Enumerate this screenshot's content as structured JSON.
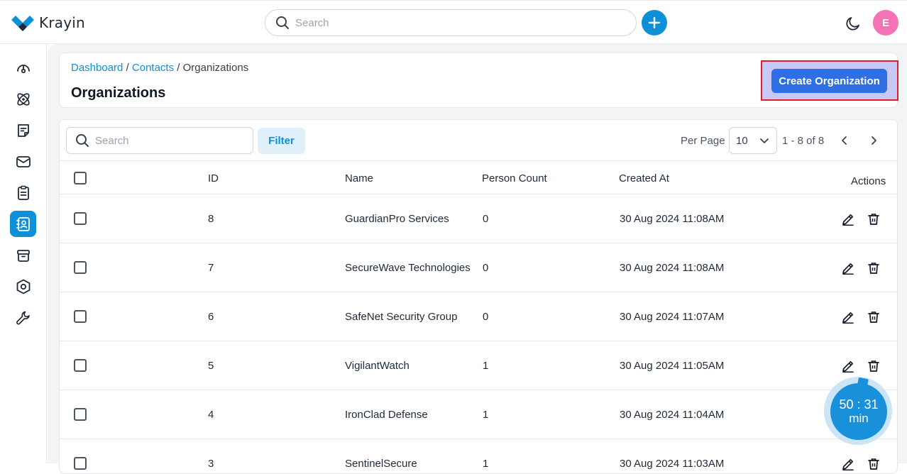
{
  "app": {
    "name": "Krayin"
  },
  "header": {
    "search_placeholder": "Search",
    "avatar_initial": "E"
  },
  "sidebar": {
    "items": [
      {
        "name": "dashboard",
        "icon": "gauge-icon",
        "active": false
      },
      {
        "name": "leads",
        "icon": "atom-icon",
        "active": false
      },
      {
        "name": "quotes",
        "icon": "note-icon",
        "active": false
      },
      {
        "name": "mail",
        "icon": "mail-icon",
        "active": false
      },
      {
        "name": "activities",
        "icon": "clipboard-icon",
        "active": false
      },
      {
        "name": "contacts",
        "icon": "contact-book-icon",
        "active": true
      },
      {
        "name": "products",
        "icon": "box-icon",
        "active": false
      },
      {
        "name": "settings",
        "icon": "gear-icon",
        "active": false
      },
      {
        "name": "configuration",
        "icon": "wrench-icon",
        "active": false
      }
    ]
  },
  "breadcrumb": {
    "items": [
      "Dashboard",
      "Contacts",
      "Organizations"
    ],
    "separator": " / "
  },
  "page": {
    "title": "Organizations",
    "create_button": "Create Organization"
  },
  "toolbar": {
    "search_placeholder": "Search",
    "filter_label": "Filter",
    "per_page_label": "Per Page",
    "per_page_value": "10",
    "range": "1 - 8 of 8"
  },
  "table": {
    "columns": [
      "ID",
      "Name",
      "Person Count",
      "Created At",
      "Actions"
    ],
    "rows": [
      {
        "id": "8",
        "name": "GuardianPro Services",
        "person_count": "0",
        "created_at": "30 Aug 2024 11:08AM"
      },
      {
        "id": "7",
        "name": "SecureWave Technologies",
        "person_count": "0",
        "created_at": "30 Aug 2024 11:08AM"
      },
      {
        "id": "6",
        "name": "SafeNet Security Group",
        "person_count": "0",
        "created_at": "30 Aug 2024 11:07AM"
      },
      {
        "id": "5",
        "name": "VigilantWatch",
        "person_count": "1",
        "created_at": "30 Aug 2024 11:05AM"
      },
      {
        "id": "4",
        "name": "IronClad Defense",
        "person_count": "1",
        "created_at": "30 Aug 2024 11:04AM"
      },
      {
        "id": "3",
        "name": "SentinelSecure",
        "person_count": "1",
        "created_at": "30 Aug 2024 11:03AM"
      }
    ]
  },
  "timer": {
    "time": "50 : 31",
    "unit": "min"
  },
  "colors": {
    "accent": "#0e90d9",
    "primary_button": "#2f6fe6",
    "highlight_border": "#e11d2b",
    "avatar": "#f472b6"
  }
}
